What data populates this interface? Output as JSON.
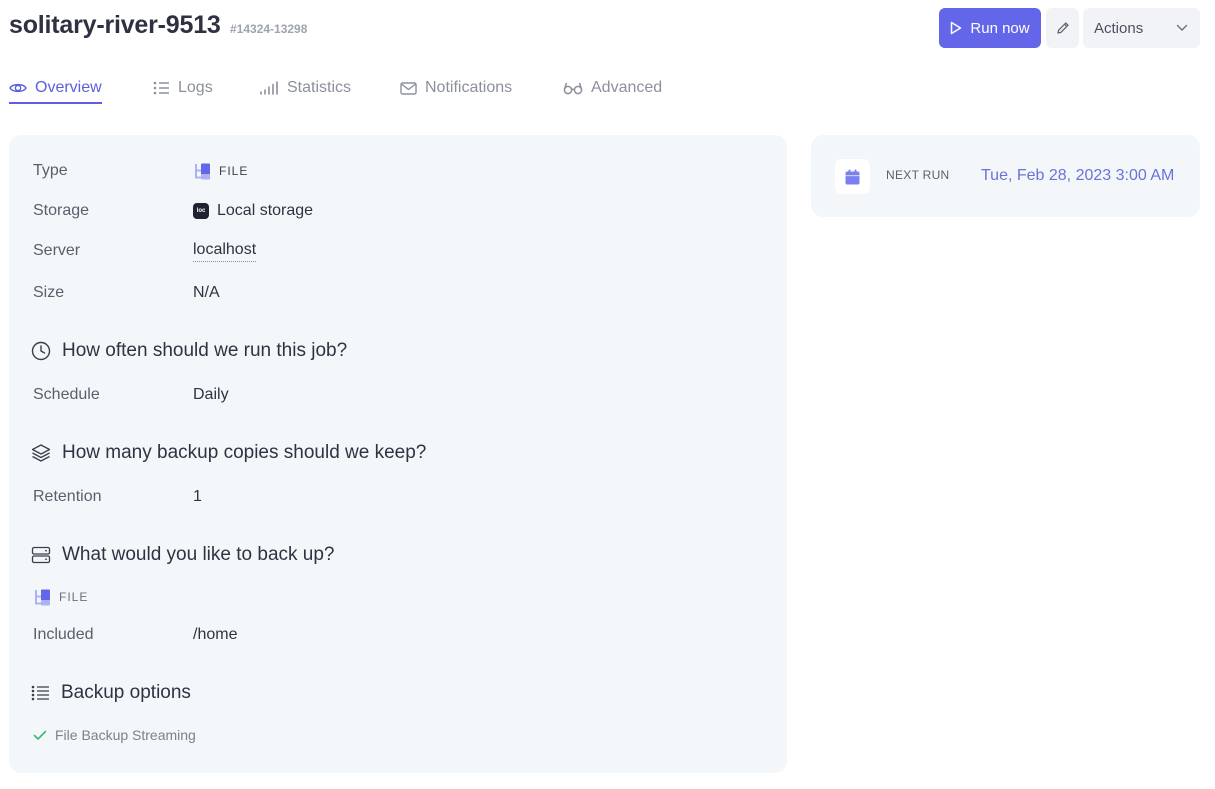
{
  "job": {
    "name": "solitary-river-9513",
    "id": "#14324-13298"
  },
  "toolbar": {
    "run_label": "Run now",
    "actions_label": "Actions"
  },
  "tabs": [
    {
      "label": "Overview",
      "active": true
    },
    {
      "label": "Logs"
    },
    {
      "label": "Statistics"
    },
    {
      "label": "Notifications"
    },
    {
      "label": "Advanced"
    }
  ],
  "details": {
    "type": {
      "label": "Type",
      "value": "FILE"
    },
    "storage": {
      "label": "Storage",
      "value": "Local storage",
      "badge": "loc"
    },
    "server": {
      "label": "Server",
      "value": "localhost"
    },
    "size": {
      "label": "Size",
      "value": "N/A"
    }
  },
  "schedule_section": {
    "heading": "How often should we run this job?",
    "label": "Schedule",
    "value": "Daily"
  },
  "retention_section": {
    "heading": "How many backup copies should we keep?",
    "label": "Retention",
    "value": "1"
  },
  "backup_section": {
    "heading": "What would you like to back up?",
    "type": "FILE",
    "included_label": "Included",
    "included_value": "/home"
  },
  "options_section": {
    "heading": "Backup options",
    "items": [
      "File Backup Streaming"
    ]
  },
  "next_run": {
    "label": "NEXT RUN",
    "value": "Tue, Feb 28, 2023 3:00 AM"
  },
  "colors": {
    "accent": "#6366e8",
    "panel": "#f4f7fa",
    "success": "#3cb878"
  }
}
